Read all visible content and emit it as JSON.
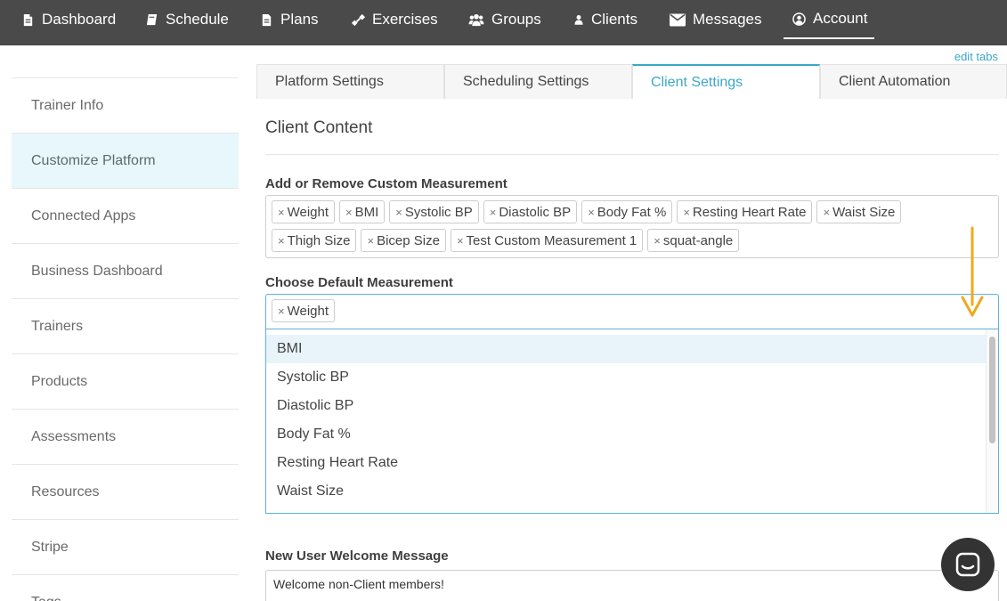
{
  "nav": {
    "items": [
      {
        "label": "Dashboard",
        "icon": "document-icon"
      },
      {
        "label": "Schedule",
        "icon": "book-icon"
      },
      {
        "label": "Plans",
        "icon": "document-icon"
      },
      {
        "label": "Exercises",
        "icon": "dumbbell-icon"
      },
      {
        "label": "Groups",
        "icon": "users-icon"
      },
      {
        "label": "Clients",
        "icon": "user-icon"
      },
      {
        "label": "Messages",
        "icon": "envelope-icon"
      },
      {
        "label": "Account",
        "icon": "account-circle-icon",
        "active": true
      }
    ]
  },
  "edit_tabs": "edit tabs",
  "sidebar": {
    "items": [
      {
        "label": "Trainer Info"
      },
      {
        "label": "Customize Platform",
        "active": true
      },
      {
        "label": "Connected Apps"
      },
      {
        "label": "Business Dashboard"
      },
      {
        "label": "Trainers"
      },
      {
        "label": "Products"
      },
      {
        "label": "Assessments"
      },
      {
        "label": "Resources"
      },
      {
        "label": "Stripe"
      },
      {
        "label": "Tags"
      }
    ]
  },
  "tabs": [
    {
      "label": "Platform Settings"
    },
    {
      "label": "Scheduling Settings"
    },
    {
      "label": "Client Settings",
      "active": true
    },
    {
      "label": "Client Automation"
    }
  ],
  "section_title": "Client Content",
  "custom_measurement": {
    "label": "Add or Remove Custom Measurement",
    "tags": [
      "Weight",
      "BMI",
      "Systolic BP",
      "Diastolic BP",
      "Body Fat %",
      "Resting Heart Rate",
      "Waist Size",
      "Thigh Size",
      "Bicep Size",
      "Test Custom Measurement 1",
      "squat-angle"
    ],
    "remove_symbol": "×"
  },
  "default_measurement": {
    "label": "Choose Default Measurement",
    "selected": [
      "Weight"
    ],
    "options": [
      "BMI",
      "Systolic BP",
      "Diastolic BP",
      "Body Fat %",
      "Resting Heart Rate",
      "Waist Size"
    ]
  },
  "welcome": {
    "label": "New User Welcome Message",
    "value": "Welcome non-Client members!"
  },
  "colors": {
    "nav_bg": "#4a4a4a",
    "accent": "#3aa8c8",
    "annotation_arrow": "#f0a81c"
  }
}
